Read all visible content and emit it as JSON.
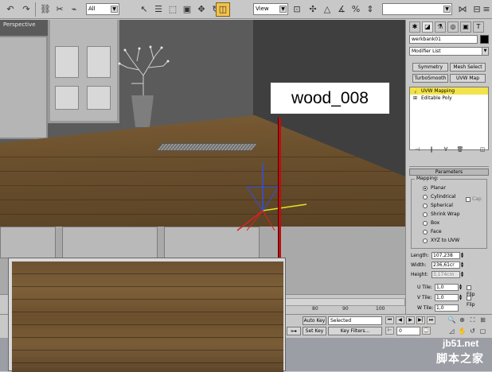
{
  "toolbar": {
    "filter_value": "All",
    "refcoord_value": "View",
    "named_selection_placeholder": ""
  },
  "viewport": {
    "label": "Perspective",
    "callout": "wood_008"
  },
  "command_panel": {
    "object_name": "werkbank01",
    "modifier_list": "Modifier List",
    "buttons": [
      "Symmetry",
      "Mesh Select",
      "TurboSmooth",
      "UVW Map"
    ],
    "stack": [
      {
        "label": "UVW Mapping",
        "selected": true
      },
      {
        "label": "Editable Poly",
        "selected": false
      }
    ],
    "rollout_title": "Parameters",
    "mapping_label": "Mapping:",
    "mapping_options": [
      "Planar",
      "Cylindrical",
      "Spherical",
      "Shrink Wrap",
      "Box",
      "Face",
      "XYZ to UVW"
    ],
    "mapping_selected": "Planar",
    "cap_label": "Cap",
    "length_label": "Length:",
    "length_value": "107,238",
    "width_label": "Width:",
    "width_value": "236,61cr",
    "height_label": "Height:",
    "height_value": "3,174cm",
    "utile_label": "U Tile:",
    "utile_value": "1,0",
    "vtile_label": "V Tile:",
    "vtile_value": "1,0",
    "wtile_label": "W Tile:",
    "wtile_value": "1,0",
    "flip_label": "Flip"
  },
  "timeline": {
    "ticks": [
      "80",
      "90",
      "100"
    ]
  },
  "bottom": {
    "auto_key": "Auto Key",
    "set_key": "Set Key",
    "selected_value": "Selected",
    "key_filters": "Key Filters...",
    "frame_value": "0"
  },
  "watermark": {
    "url": "jb51.net",
    "name": "脚本之家"
  }
}
